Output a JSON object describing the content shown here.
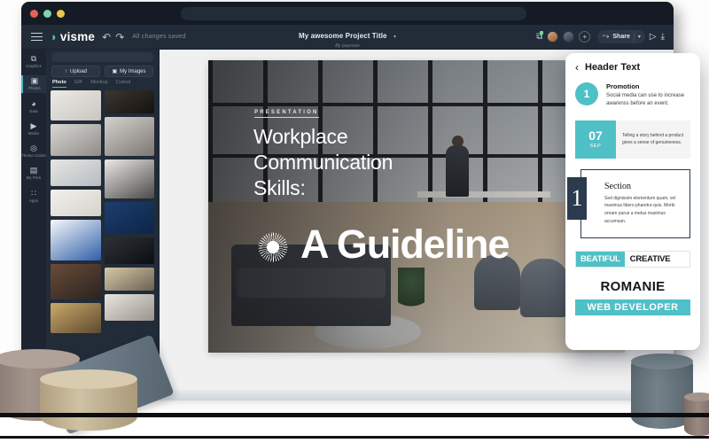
{
  "window": {
    "traffic_lights": [
      "close",
      "minimize",
      "maximize"
    ],
    "address_bar_value": "",
    "address_bar_placeholder": ""
  },
  "topbar": {
    "menu_icon": "hamburger-icon",
    "brand_name": "visme",
    "brand_mark": "◗",
    "undo_label": "↶",
    "redo_label": "↷",
    "saved_status": "All changes saved",
    "project_title": "My awesome Project Title",
    "project_author": "By payman",
    "title_caret": "▾",
    "present_icon": "▷",
    "download_icon": "⤓",
    "notes_icon": "⧉",
    "add_member_label": "+",
    "share_label": "Share",
    "share_caret": "▾",
    "share_icon": "⤳"
  },
  "rail": {
    "items": [
      {
        "label": "Graphics",
        "icon": "⧉"
      },
      {
        "label": "Photos",
        "icon": "▣"
      },
      {
        "label": "Data",
        "icon": "◕"
      },
      {
        "label": "Media",
        "icon": "▶"
      },
      {
        "label": "Theme Colors",
        "icon": "◎"
      },
      {
        "label": "My Files",
        "icon": "▤"
      },
      {
        "label": "Apps",
        "icon": "∷"
      }
    ],
    "active_index": 1
  },
  "photo_panel": {
    "search_value": "",
    "search_placeholder": "",
    "upload_label": "Upload",
    "upload_icon": "↑",
    "my_images_label": "My Images",
    "my_images_icon": "▣",
    "tabs": [
      "Photo",
      "GIF",
      "Mockup",
      "Cutout"
    ],
    "active_tab": "Photo",
    "thumbnails_left": [
      {
        "name": "desk-lamp-workspace",
        "height": 34,
        "c1": "#eceae6",
        "c2": "#c9c6c0"
      },
      {
        "name": "hands-tablet-flatlay",
        "height": 36,
        "c1": "#d9d7d3",
        "c2": "#8e8b88"
      },
      {
        "name": "office-meeting-group",
        "height": 30,
        "c1": "#e6e6e4",
        "c2": "#b6bcc2"
      },
      {
        "name": "white-desk-flatlay",
        "height": 30,
        "c1": "#f2f1ee",
        "c2": "#d6d2cb"
      },
      {
        "name": "blue-paint-abstract",
        "height": 46,
        "c1": "#f7f8fa",
        "c2": "#2f5fa8"
      },
      {
        "name": "open-office-workers",
        "height": 40,
        "c1": "#6a4b38",
        "c2": "#2a2420"
      },
      {
        "name": "woman-yellow-room",
        "height": 34,
        "c1": "#caa96a",
        "c2": "#5d4a31"
      }
    ],
    "thumbnails_right": [
      {
        "name": "laptop-desk-dark",
        "height": 26,
        "c1": "#3c3631",
        "c2": "#15120f"
      },
      {
        "name": "designer-at-monitor",
        "height": 44,
        "c1": "#d5d2cd",
        "c2": "#7b7773"
      },
      {
        "name": "laptop-sleeve-mockup",
        "height": 44,
        "c1": "#eceae7",
        "c2": "#4c4a48"
      },
      {
        "name": "blue-cafe-seating",
        "height": 36,
        "c1": "#1c3f6e",
        "c2": "#0d2447"
      },
      {
        "name": "dark-keyboard-closeup",
        "height": 30,
        "c1": "#2d3136",
        "c2": "#0c0e11"
      },
      {
        "name": "two-men-at-counter",
        "height": 26,
        "c1": "#d6c9a8",
        "c2": "#6b6152"
      },
      {
        "name": "woman-on-bed-laptop",
        "height": 30,
        "c1": "#e9e6e1",
        "c2": "#9a938b"
      }
    ]
  },
  "slide": {
    "kicker": "PRESENTATION",
    "heading_line1": "Workplace",
    "heading_line2": "Communication",
    "heading_line3": "Skills:",
    "big_title": "A Guideline",
    "decor_icon": "sunburst-icon"
  },
  "panel": {
    "back_icon": "‹",
    "title": "Header Text",
    "promotion": {
      "number": "1",
      "title": "Promotion",
      "body": "Social media can use to increase awarenss before an event."
    },
    "date_block": {
      "day": "07",
      "month": "SEP",
      "text": "Telling a story behind a product gives a sense of genuineness."
    },
    "section": {
      "number": "1",
      "title": "Section",
      "body": "Sed dignissim elementum quam, vel maximus libero pharetra quis. Morbi ornare purus a metus maximus accumsan."
    },
    "badge": {
      "left": "BEATIFUL",
      "right": "CREATIVE"
    },
    "name_card": {
      "name": "ROMANIE",
      "role": "WEB DEVELOPER"
    }
  },
  "colors": {
    "teal": "#4fc0c6",
    "navy": "#2c3a4e",
    "app_bg": "#222b38",
    "rail_bg": "#1d2531",
    "canvas_bg": "#f0f0f1"
  }
}
